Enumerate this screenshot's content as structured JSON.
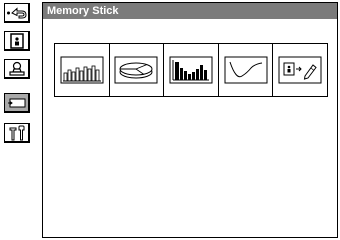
{
  "window": {
    "title": "Memory Stick"
  },
  "sidebar": {
    "items": [
      {
        "icon": "back-arrow-icon"
      },
      {
        "icon": "person-card-icon"
      },
      {
        "icon": "stamp-icon"
      },
      {
        "icon": "memory-stick-icon",
        "selected": true
      },
      {
        "icon": "tools-icon"
      }
    ]
  },
  "tiles": [
    {
      "icon": "bar-chart-icon"
    },
    {
      "icon": "pie-chart-icon"
    },
    {
      "icon": "step-bar-chart-icon"
    },
    {
      "icon": "line-graph-icon"
    },
    {
      "icon": "card-to-pen-icon"
    }
  ],
  "colors": {
    "titlebar": "#7b7b7b",
    "selected_button": "#a9a9a9"
  }
}
